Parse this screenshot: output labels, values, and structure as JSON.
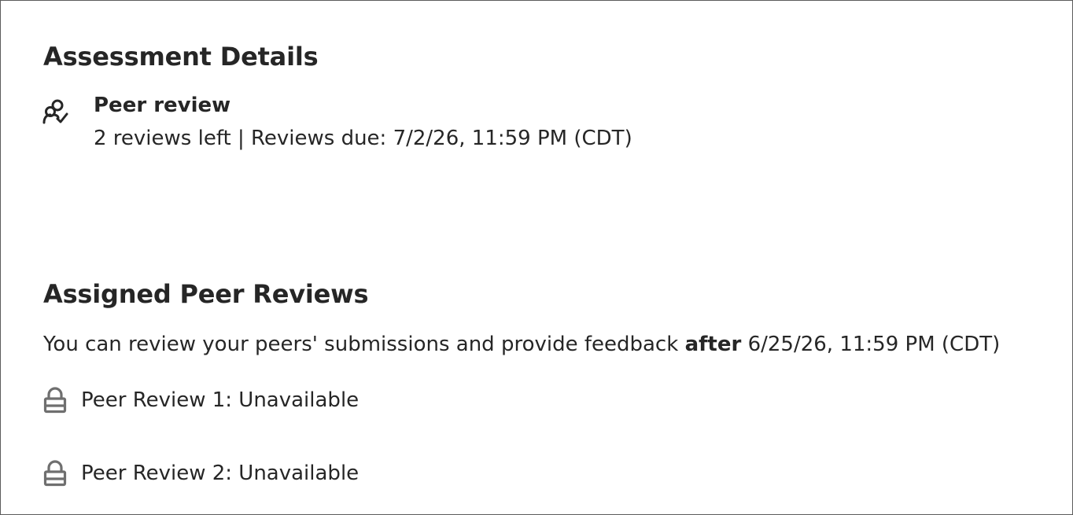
{
  "details": {
    "title": "Assessment Details",
    "peer_review": {
      "icon": "peer-review-icon",
      "label": "Peer review",
      "meta": "2 reviews left | Reviews due: 7/2/26, 11:59 PM (CDT)"
    }
  },
  "assigned": {
    "title": "Assigned Peer Reviews",
    "intro_prefix": "You can review your peers' submissions and provide feedback",
    "intro_emphasis": "after",
    "intro_suffix": "6/25/26, 11:59 PM (CDT)",
    "reviews": [
      {
        "icon": "lock-icon",
        "label": "Peer Review 1: Unavailable"
      },
      {
        "icon": "lock-icon",
        "label": "Peer Review 2: Unavailable"
      }
    ]
  },
  "colors": {
    "text": "#262626",
    "border": "#5c5c5c",
    "icon_gray": "#6f6f6f"
  }
}
